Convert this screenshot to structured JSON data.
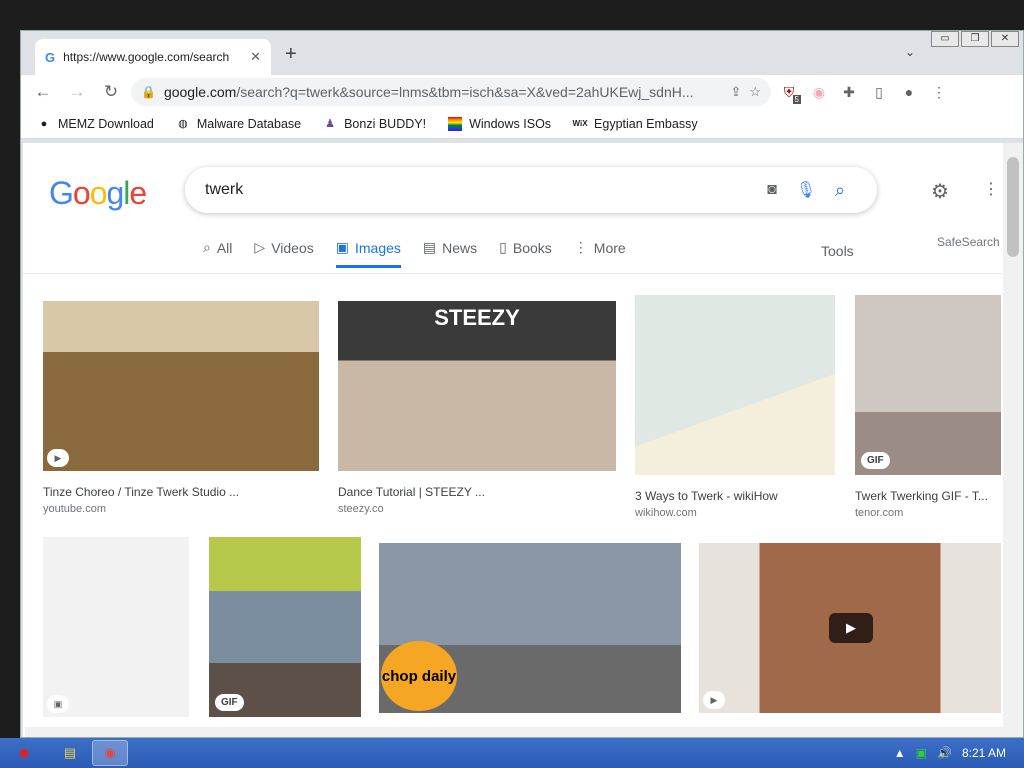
{
  "browser": {
    "tab_title": "https://www.google.com/search",
    "new_tab": "+",
    "url_host": "google.com",
    "url_path": "/search?q=twerk&source=lnms&tbm=isch&sa=X&ved=2ahUKEwj_sdnH...",
    "ext_badge": "5"
  },
  "bookmarks": [
    {
      "label": "MEMZ Download",
      "icon": "github-icon"
    },
    {
      "label": "Malware Database",
      "icon": "globe-icon"
    },
    {
      "label": "Bonzi BUDDY!",
      "icon": "bonzi-icon"
    },
    {
      "label": "Windows ISOs",
      "icon": "rainbow-flag-icon"
    },
    {
      "label": "Egyptian Embassy",
      "icon": "wix-icon"
    }
  ],
  "google": {
    "logo": "Google",
    "query": "twerk",
    "tabs": [
      {
        "label": "All",
        "icon": "search-icon"
      },
      {
        "label": "Videos",
        "icon": "play-icon"
      },
      {
        "label": "Images",
        "icon": "image-icon"
      },
      {
        "label": "News",
        "icon": "news-icon"
      },
      {
        "label": "Books",
        "icon": "book-icon"
      },
      {
        "label": "More",
        "icon": "more-icon"
      }
    ],
    "tools": "Tools",
    "safesearch": "SafeSearch"
  },
  "results": [
    {
      "caption": "Tinze Choreo / Tinze Twerk Studio ...",
      "source": "youtube.com",
      "badge": "",
      "color": "#8a6a3c"
    },
    {
      "caption": "Dance Tutorial | STEEZY ...",
      "source": "steezy.co",
      "badge": "",
      "color": "#c9b8a6",
      "overlay": "STEEZY"
    },
    {
      "caption": "3 Ways to Twerk - wikiHow",
      "source": "wikihow.com",
      "badge": "",
      "color": "#e7eee6"
    },
    {
      "caption": "Twerk Twerking GIF - T...",
      "source": "tenor.com",
      "badge": "GIF",
      "color": "#9b8d86"
    },
    {
      "caption": "",
      "source": "",
      "badge": "",
      "color": "#f2f2f2"
    },
    {
      "caption": "",
      "source": "",
      "badge": "GIF",
      "color": "#7a8ea0"
    },
    {
      "caption": "",
      "source": "",
      "badge": "",
      "color": "#8b97a6",
      "overlay": "chop daily"
    },
    {
      "caption": "",
      "source": "",
      "badge": "",
      "color": "#a06a4a"
    }
  ],
  "taskbar": {
    "time": "8:21 AM"
  }
}
